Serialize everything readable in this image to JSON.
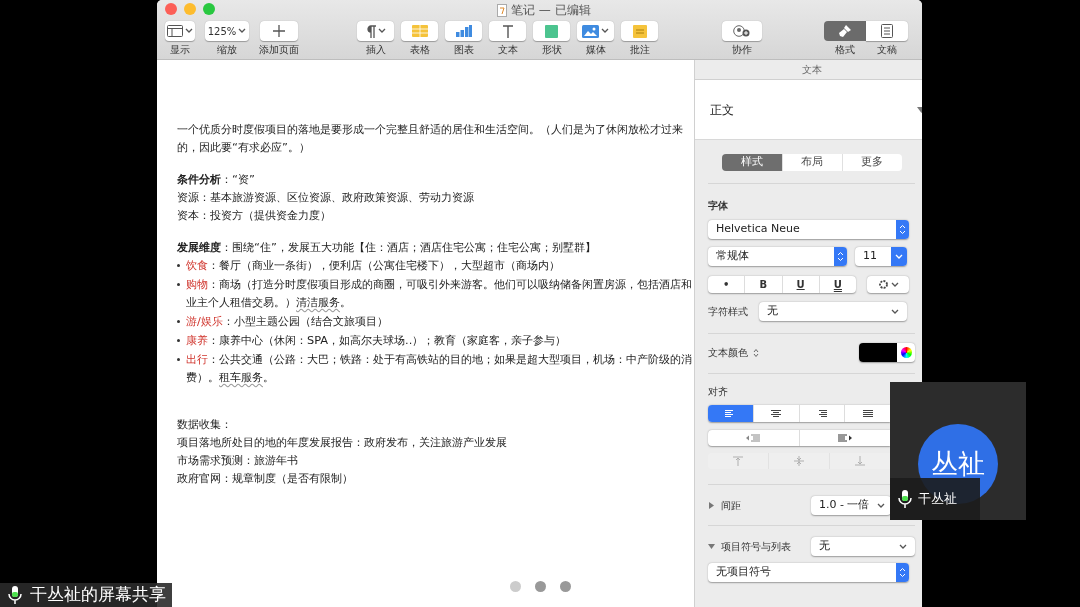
{
  "window": {
    "title": "笔记 — 已编辑"
  },
  "toolbar": {
    "left": [
      {
        "kind": "view",
        "label": "显示",
        "menu": true
      },
      {
        "kind": "zoom",
        "label": "缩放",
        "value": "125%",
        "menu": true
      },
      {
        "kind": "add",
        "label": "添加页面",
        "menu": false
      }
    ],
    "center": [
      {
        "kind": "insert",
        "label": "插入",
        "menu": true
      },
      {
        "kind": "table",
        "label": "表格",
        "menu": false
      },
      {
        "kind": "chart",
        "label": "图表",
        "menu": false
      },
      {
        "kind": "text",
        "label": "文本",
        "menu": false
      },
      {
        "kind": "shape",
        "label": "形状",
        "menu": false
      },
      {
        "kind": "media",
        "label": "媒体",
        "menu": true
      },
      {
        "kind": "comment",
        "label": "批注",
        "menu": false
      }
    ],
    "collaborate": {
      "label": "协作"
    },
    "panels": [
      {
        "kind": "format",
        "label": "格式",
        "selected": true
      },
      {
        "kind": "document",
        "label": "文稿",
        "selected": false
      }
    ]
  },
  "document": {
    "blocks": [
      {
        "kind": "para",
        "text": "一个优质分时度假项目的落地是要形成一个完整且舒适的居住和生活空间。（人们是为了休闲放松才过来的，因此要“有求必应”。）"
      },
      {
        "kind": "gap"
      },
      {
        "kind": "para",
        "text": "**条件分析**：“资”"
      },
      {
        "kind": "para",
        "text": "资源：基本旅游资源、区位资源、政府政策资源、劳动力资源"
      },
      {
        "kind": "para",
        "text": "资本：投资方（提供资金力度）"
      },
      {
        "kind": "gap"
      },
      {
        "kind": "para",
        "text": "**发展维度**：围绕“住”，发展五大功能【住：酒店；酒店住宅公寓；住宅公寓；别墅群】"
      },
      {
        "kind": "bullet",
        "lead": "饮食",
        "text": "：餐厅（商业一条街），便利店（公寓住宅楼下），大型超市（商场内）"
      },
      {
        "kind": "bullet",
        "lead": "购物",
        "text": "：商场（打造分时度假项目形成的商圈，可吸引外来游客。他们可以吸纳储备闲置房源，包括酒店和业主个人租借交易。）",
        "flagged": "清洁服务",
        "rest": "。"
      },
      {
        "kind": "bullet",
        "lead": "游/娱乐",
        "text": "：小型主题公园（结合文旅项目）"
      },
      {
        "kind": "bullet",
        "lead": "康养",
        "text": "：康养中心（休闲：SPA，如高尔夫球场..）；教育（家庭客，亲子参与）"
      },
      {
        "kind": "bullet",
        "lead": "出行",
        "text": "：公共交通（公路：大巴；铁路：处于有高铁站的目的地；如果是超大型项目，机场：中产阶级的消费）。",
        "flagged": "租车服务",
        "rest": "。"
      },
      {
        "kind": "gap"
      },
      {
        "kind": "gap"
      },
      {
        "kind": "para",
        "text": "数据收集："
      },
      {
        "kind": "para",
        "text": "项目落地所处目的地的年度发展报告：政府发布，关注旅游产业发展"
      },
      {
        "kind": "para",
        "text": "市场需求预测：旅游年书"
      },
      {
        "kind": "para",
        "text": "政府官网：规章制度（是否有限制）"
      }
    ]
  },
  "sidebar": {
    "header": "文本",
    "paragraph_style": "正文",
    "tabs": [
      {
        "label": "样式",
        "selected": true
      },
      {
        "label": "布局",
        "selected": false
      },
      {
        "label": "更多",
        "selected": false
      }
    ],
    "font_label": "字体",
    "font": "Helvetica Neue",
    "typeface": "常规体",
    "size": "11",
    "style_buttons": [
      "•",
      "B",
      "U",
      "U"
    ],
    "char_style_label": "字符样式",
    "char_style": "无",
    "color_label": "文本颜色",
    "align_label": "对齐",
    "alignment": [
      {
        "kind": "left",
        "selected": true
      },
      {
        "kind": "center",
        "selected": false
      },
      {
        "kind": "right",
        "selected": false
      },
      {
        "kind": "justify",
        "selected": false
      }
    ],
    "vertical_align_disabled": true,
    "spacing_label": "间距",
    "spacing": "1.0 - 一倍",
    "spacing_expanded": false,
    "bullets_label": "项目符号与列表",
    "bullets": "无",
    "bullets_expanded": true,
    "bullet_style": "无项目符号"
  },
  "participant": {
    "avatar": "丛祉",
    "name": "干丛祉"
  },
  "share_label": "干丛祉的屏幕共享"
}
